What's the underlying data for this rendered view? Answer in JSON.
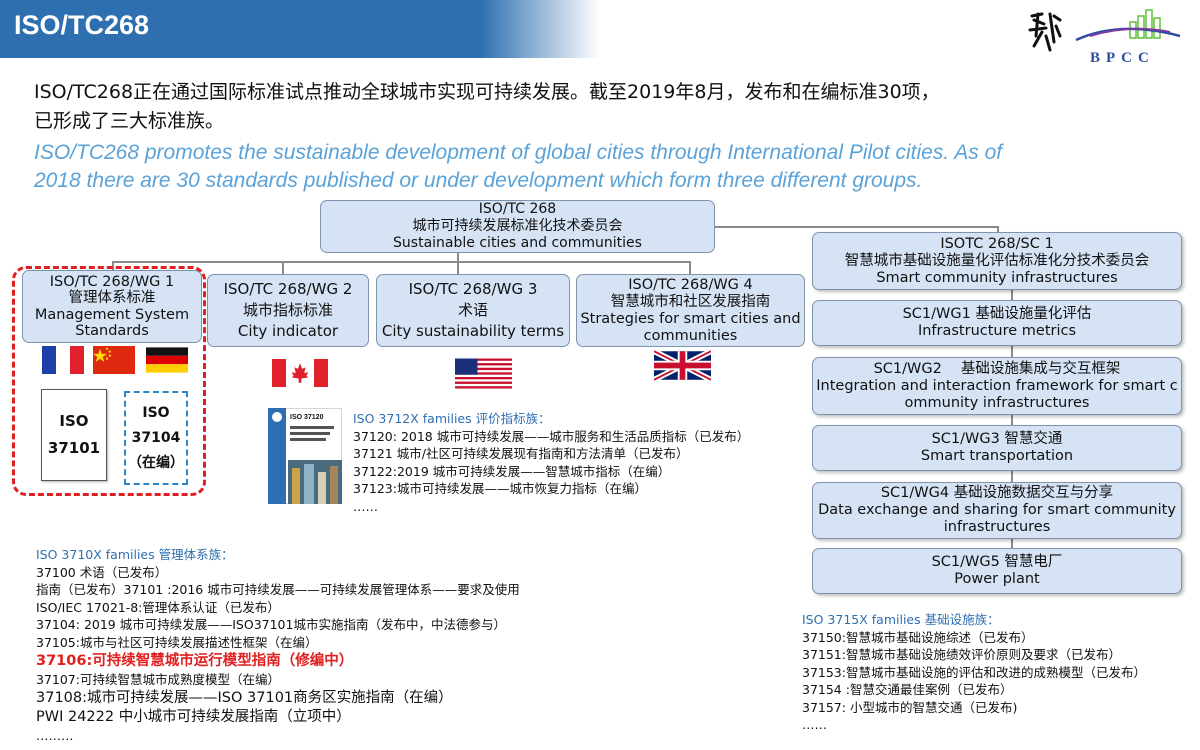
{
  "header": {
    "title": "ISO/TC268"
  },
  "logo": {
    "text": "BPCC",
    "calligraphy": "御道"
  },
  "intro": {
    "zh_line1": "ISO/TC268正在通过国际标准试点推动全球城市实现可持续发展。截至2019年8月，发布和在编标准30项，",
    "zh_line2": "已形成了三大标准族。",
    "en_line1": "ISO/TC268 promotes the sustainable development of global cities through International Pilot cities. As of",
    "en_line2": "2018 there are 30 standards published or under development which form three different groups."
  },
  "top": {
    "l1": "ISO/TC 268",
    "l2": "城市可持续发展标准化技术委员会",
    "l3": "Sustainable cities and communities"
  },
  "wg": [
    {
      "l1": "ISO/TC 268/WG 1",
      "l2": "管理体系标准",
      "l3": "Management System",
      "l4": "Standards"
    },
    {
      "l1": "ISO/TC 268/WG 2",
      "l2": "城市指标标准",
      "l3": "City indicator"
    },
    {
      "l1": "ISO/TC 268/WG 3",
      "l2": "术语",
      "l3": "City sustainability terms"
    },
    {
      "l1": "ISO/TC 268/WG 4",
      "l2": "智慧城市和社区发展指南",
      "l3": "Strategies for smart cities and",
      "l4": "communities"
    }
  ],
  "sc": {
    "head": {
      "l1": "ISOTC 268/SC 1",
      "l2": "智慧城市基础设施量化评估标准化分技术委员会",
      "l3": "Smart community infrastructures"
    },
    "wgs": [
      {
        "l1": "SC1/WG1 基础设施量化评估",
        "l2": "Infrastructure metrics"
      },
      {
        "l1": "SC1/WG2　 基础设施集成与交互框架",
        "l2": "Integration and interaction framework for smart c",
        "l3": "ommunity infrastructures"
      },
      {
        "l1": "SC1/WG3 智慧交通",
        "l2": "Smart transportation"
      },
      {
        "l1": "SC1/WG4 基础设施数据交互与分享",
        "l2": "Data exchange and sharing for smart community",
        "l3": "infrastructures"
      },
      {
        "l1": "SC1/WG5 智慧电厂",
        "l2": "Power plant"
      }
    ]
  },
  "docs": {
    "d1": {
      "l1": "ISO",
      "l2": "37101"
    },
    "d2": {
      "l1": "ISO",
      "l2": "37104",
      "l3": "（在编）"
    }
  },
  "cover": {
    "label": "ISO 37120"
  },
  "flags": [
    "france-flag",
    "china-flag",
    "germany-flag",
    "canada-flag",
    "usa-flag",
    "uk-flag"
  ],
  "list3712": {
    "title": "ISO 3712X families 评价指标族：",
    "items": [
      "37120: 2018 城市可持续发展——城市服务和生活品质指标（已发布）",
      "37121 城市/社区可持续发展现有指南和方法清单（已发布）",
      "37122:2019  城市可持续发展——智慧城市指标（在编）",
      "37123:城市可持续发展——城市恢复力指标（在编）",
      "……"
    ]
  },
  "list3710": {
    "title": "ISO 3710X families 管理体系族：",
    "items": [
      "37100 术语（已发布）",
      "指南（已发布）37101 :2016 城市可持续发展——可持续发展管理体系——要求及使用",
      "ISO/IEC 17021-8:管理体系认证（已发布）",
      "37104:  2019 城市可持续发展——ISO37101城市实施指南（发布中，中法德参与）",
      "37105:城市与社区可持续发展描述性框架（在编）"
    ],
    "highlight": "37106:可持续智慧城市运行模型指南（修编中）",
    "items2": [
      "37107:可持续智慧城市成熟度模型（在编）"
    ],
    "big": [
      "37108:城市可持续发展——ISO 37101商务区实施指南（在编）",
      "PWI 24222 中小城市可持续发展指南（立项中）"
    ],
    "more": "………"
  },
  "list3715": {
    "title": "ISO 3715X families 基础设施族：",
    "items": [
      "37150:智慧城市基础设施综述（已发布）",
      "37151:智慧城市基础设施绩效评价原则及要求（已发布）",
      "37153:智慧城市基础设施的评估和改进的成熟模型（已发布）",
      "37154 :智慧交通最佳案例（已发布）",
      "37157:  小型城市的智慧交通（已发布)",
      "……"
    ]
  },
  "colors": {
    "header": "#2e6fb0",
    "box": "#d6e3f5",
    "english": "#5aa2d8",
    "highlight": "#e02020",
    "dashRed": "#e02020",
    "dashBlue": "#2e86c8"
  }
}
